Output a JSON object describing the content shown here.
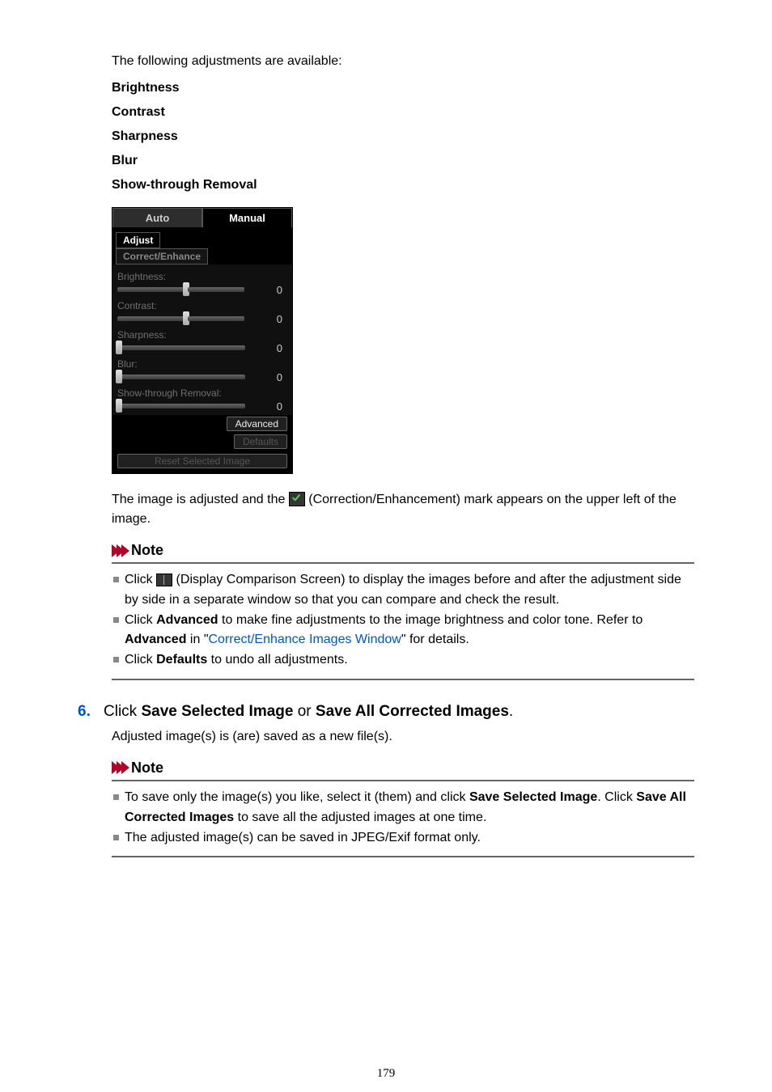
{
  "intro": "The following adjustments are available:",
  "defs": {
    "brightness": "Brightness",
    "contrast": "Contrast",
    "sharpness": "Sharpness",
    "blur": "Blur",
    "showthrough": "Show-through Removal"
  },
  "panel": {
    "tabAuto": "Auto",
    "tabManual": "Manual",
    "sectAdjust": "Adjust",
    "sectCorrect": "Correct/Enhance",
    "brightnessLabel": "Brightness:",
    "contrastLabel": "Contrast:",
    "sharpnessLabel": "Sharpness:",
    "blurLabel": "Blur:",
    "showthroughLabel": "Show-through Removal:",
    "val0": "0",
    "btnAdvanced": "Advanced",
    "btnDefaults": "Defaults",
    "btnReset": "Reset Selected Image"
  },
  "afterPanel": {
    "pre": "The image is adjusted and the ",
    "post": " (Correction/Enhancement) mark appears on the upper left of the image."
  },
  "noteLabel": "Note",
  "note1": {
    "li1_pre": "Click ",
    "li1_post": " (Display Comparison Screen) to display the images before and after the adjustment side by side in a separate window so that you can compare and check the result.",
    "li2_a": "Click ",
    "li2_b": "Advanced",
    "li2_c": " to make fine adjustments to the image brightness and color tone. Refer to ",
    "li2_d": "Advanced",
    "li2_e": " in \"",
    "li2_link": "Correct/Enhance Images Window",
    "li2_f": "\" for details.",
    "li3_a": "Click ",
    "li3_b": "Defaults",
    "li3_c": " to undo all adjustments."
  },
  "step6": {
    "num": "6.",
    "a": "Click ",
    "b": "Save Selected Image",
    "c": " or ",
    "d": "Save All Corrected Images",
    "e": "."
  },
  "step6_sub": "Adjusted image(s) is (are) saved as a new file(s).",
  "note2": {
    "li1_a": "To save only the image(s) you like, select it (them) and click ",
    "li1_b": "Save Selected Image",
    "li1_c": ". Click ",
    "li1_d": "Save All Corrected Images",
    "li1_e": " to save all the adjusted images at one time.",
    "li2": "The adjusted image(s) can be saved in JPEG/Exif format only."
  },
  "pageNumber": "179"
}
